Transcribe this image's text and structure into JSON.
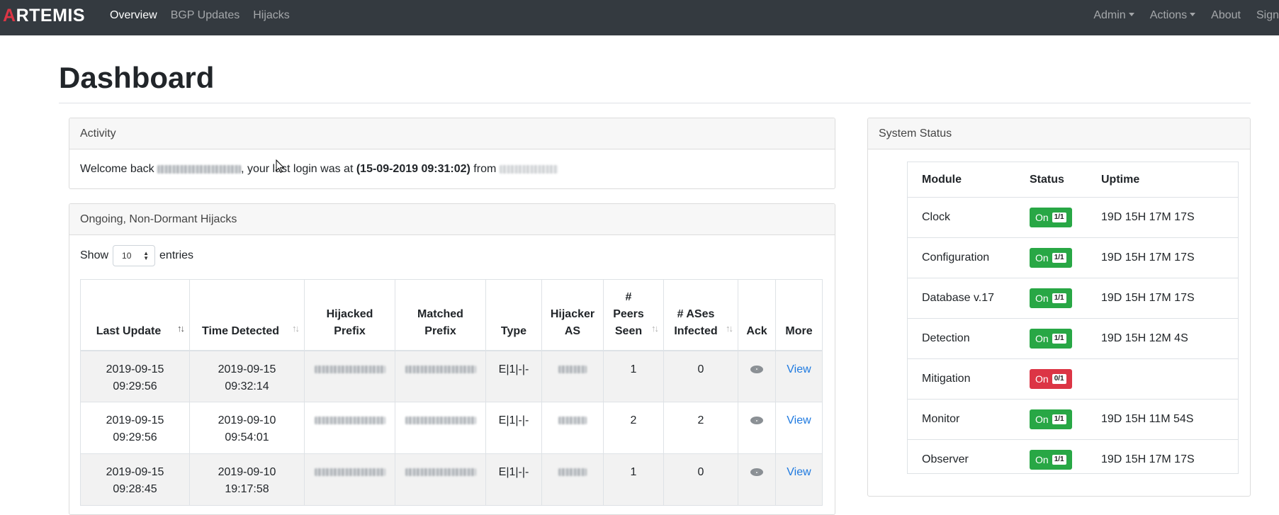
{
  "navbar": {
    "brand": "RTEMIS",
    "brand_prefix": "A",
    "left_links": [
      {
        "label": "Overview",
        "active": true
      },
      {
        "label": "BGP Updates",
        "active": false
      },
      {
        "label": "Hijacks",
        "active": false
      }
    ],
    "admin_label": "Admin",
    "actions_label": "Actions",
    "about_label": "About",
    "sign_label": "Sign"
  },
  "page": {
    "title": "Dashboard"
  },
  "activity": {
    "header": "Activity",
    "welcome_prefix": "Welcome back",
    "login_text": ", your last login was at",
    "login_time": "(15-09-2019 09:31:02)",
    "from_text": "from"
  },
  "hijacks": {
    "header": "Ongoing, Non-Dormant Hijacks",
    "show_label": "Show",
    "entries_value": "10",
    "entries_label": "entries",
    "columns": {
      "last_update": "Last Update",
      "time_detected": "Time Detected",
      "hijacked_prefix_1": "Hijacked",
      "hijacked_prefix_2": "Prefix",
      "matched_prefix_1": "Matched",
      "matched_prefix_2": "Prefix",
      "type": "Type",
      "hijacker_as_1": "Hijacker",
      "hijacker_as_2": "AS",
      "peers_1": "#",
      "peers_2": "Peers",
      "peers_3": "Seen",
      "ases_1": "# ASes",
      "ases_2": "Infected",
      "ack": "Ack",
      "more": "More"
    },
    "rows": [
      {
        "last_update_date": "2019-09-15",
        "last_update_time": "09:29:56",
        "detected_date": "2019-09-15",
        "detected_time": "09:32:14",
        "type": "E|1|-|-",
        "peers": "1",
        "ases": "0",
        "more": "View"
      },
      {
        "last_update_date": "2019-09-15",
        "last_update_time": "09:29:56",
        "detected_date": "2019-09-10",
        "detected_time": "09:54:01",
        "type": "E|1|-|-",
        "peers": "2",
        "ases": "2",
        "more": "View"
      },
      {
        "last_update_date": "2019-09-15",
        "last_update_time": "09:28:45",
        "detected_date": "2019-09-10",
        "detected_time": "19:17:58",
        "type": "E|1|-|-",
        "peers": "1",
        "ases": "0",
        "more": "View"
      }
    ]
  },
  "system_status": {
    "header": "System Status",
    "columns": {
      "module": "Module",
      "status": "Status",
      "uptime": "Uptime"
    },
    "modules": [
      {
        "name": "Clock",
        "status": "On",
        "count": "1/1",
        "state": "on",
        "uptime": "19D 15H 17M 17S"
      },
      {
        "name": "Configuration",
        "status": "On",
        "count": "1/1",
        "state": "on",
        "uptime": "19D 15H 17M 17S"
      },
      {
        "name": "Database v.17",
        "status": "On",
        "count": "1/1",
        "state": "on",
        "uptime": "19D 15H 17M 17S"
      },
      {
        "name": "Detection",
        "status": "On",
        "count": "1/1",
        "state": "on",
        "uptime": "19D 15H 12M 4S"
      },
      {
        "name": "Mitigation",
        "status": "On",
        "count": "0/1",
        "state": "off",
        "uptime": ""
      },
      {
        "name": "Monitor",
        "status": "On",
        "count": "1/1",
        "state": "on",
        "uptime": "19D 15H 11M 54S"
      },
      {
        "name": "Observer",
        "status": "On",
        "count": "1/1",
        "state": "on",
        "uptime": "19D 15H 17M 17S"
      }
    ]
  },
  "colors": {
    "navbar_bg": "#343a40",
    "status_on": "#28a745",
    "status_off": "#dc3545",
    "link": "#1f7ae0"
  }
}
